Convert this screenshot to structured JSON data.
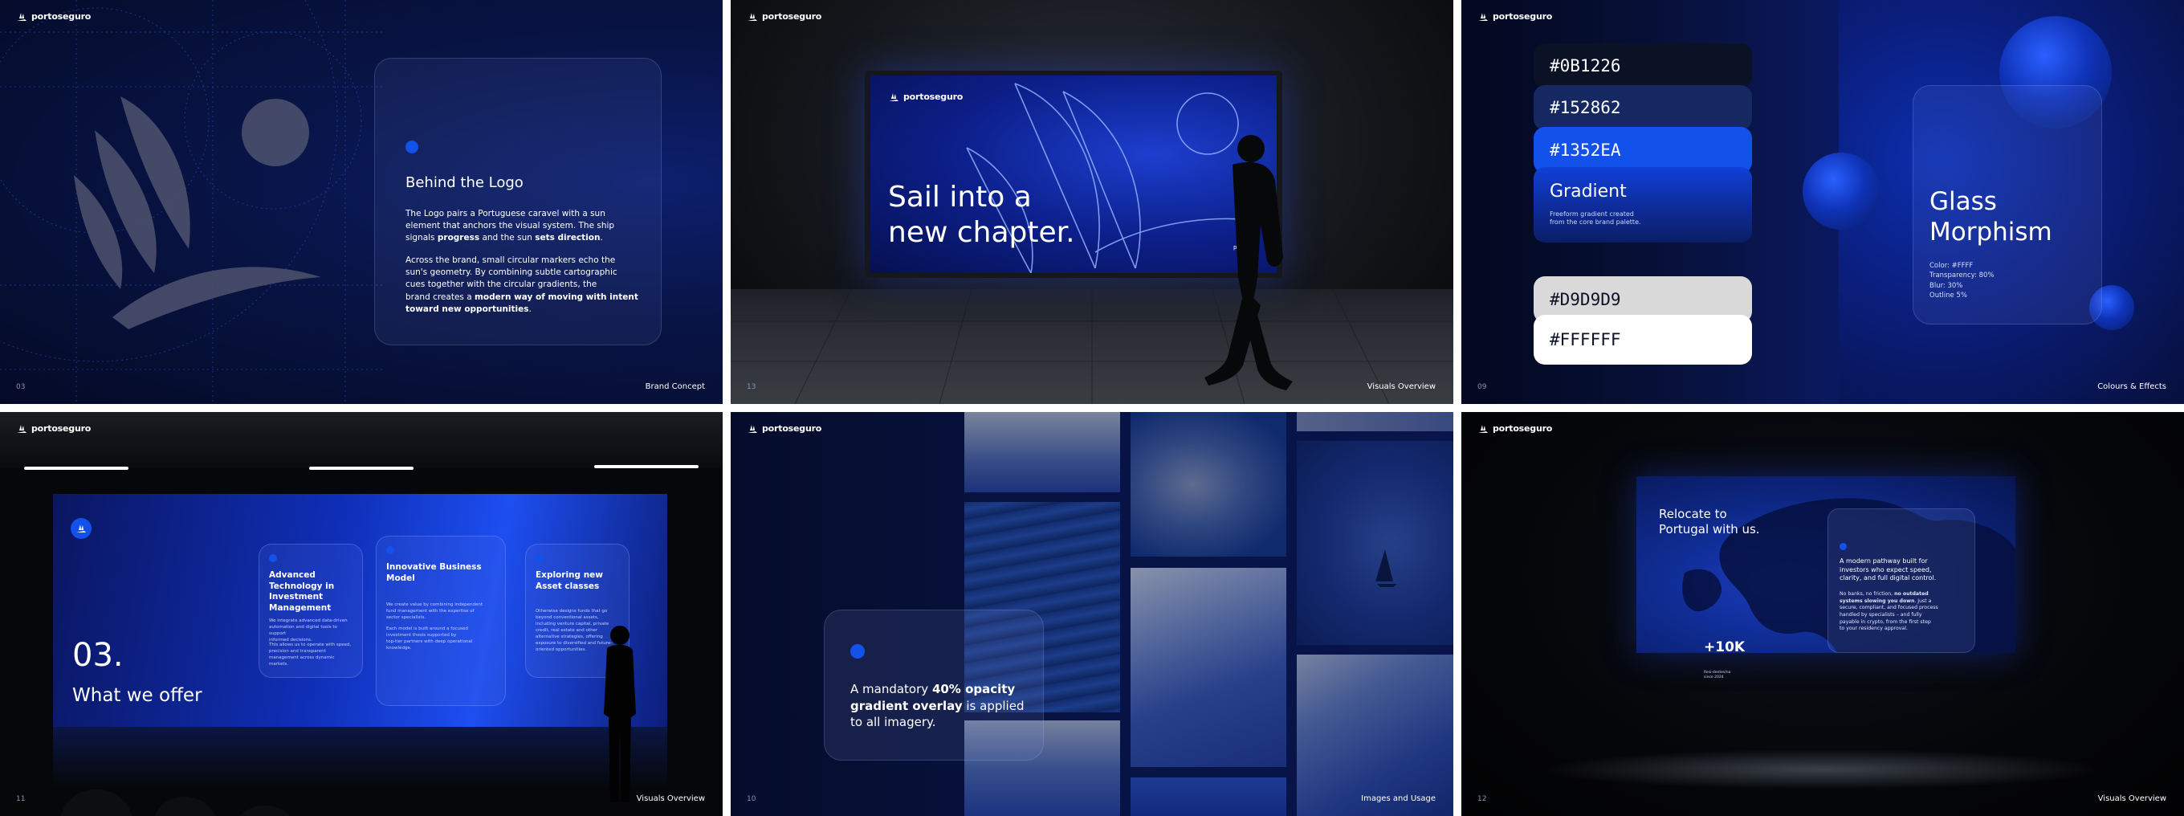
{
  "brand": "portoseguro",
  "colors": {
    "primary": "#0B1226",
    "secondary": "#152862",
    "accent": "#1352EA",
    "light_grey": "#D9D9D9",
    "white": "#FFFFFF"
  },
  "slides": {
    "s1": {
      "page": "03",
      "section": "Brand Concept",
      "card": {
        "title": "Behind the Logo",
        "p1": [
          "The Logo pairs a Portuguese caravel with a sun",
          "element that anchors the visual system. The ship",
          "signals ",
          "progress",
          " and the sun ",
          "sets direction",
          "."
        ],
        "p2": [
          "Across the brand, small circular markers echo the",
          "sun's geometry. By combining subtle cartographic",
          "cues together with the circular gradients, the",
          "brand creates a ",
          "modern way of moving with intent",
          "toward new opportunities",
          "."
        ]
      }
    },
    "s2": {
      "page": "13",
      "section": "Visuals Overview",
      "billboard": {
        "line1": "Sail into a",
        "line2": "new chapter.",
        "corner": "port"
      }
    },
    "s3": {
      "page": "09",
      "section": "Colours & Effects",
      "swatches": [
        {
          "label": "#0B1226",
          "color": "#0B1226"
        },
        {
          "label": "#152862",
          "color": "#152862"
        },
        {
          "label": "#1352EA",
          "color": "#1352EA"
        }
      ],
      "gradient": {
        "title": "Gradient",
        "sub1": "Freeform gradient created",
        "sub2": "from the core brand palette."
      },
      "light_swatches": [
        {
          "label": "#D9D9D9",
          "color": "#D9D9D9"
        },
        {
          "label": "#FFFFFF",
          "color": "#FFFFFF"
        }
      ],
      "glass": {
        "title1": "Glass",
        "title2": "Morphism",
        "spec1": "Color: #FFFF",
        "spec2": "Transparency: 80%",
        "spec3": "Blur: 30%",
        "spec4": "Outline 5%"
      }
    },
    "s4": {
      "page": "11",
      "section": "Visuals Overview",
      "number": "03.",
      "heading": "What we offer",
      "cards": [
        {
          "title": "Advanced Technology in Investment Management",
          "b1": "We integrate advanced data-driven",
          "b2": "automation and digital tools to support",
          "b3": "informed decisions.",
          "b4": "This allows us to operate with speed,",
          "b5": "precision and transparent",
          "b6": "management across dynamic markets."
        },
        {
          "title": "Innovative Business Model",
          "b1": "We create value by combining independent",
          "b2": "fund management with the expertise of",
          "b3": "sector specialists.",
          "b4": "Each model is built around a focused",
          "b5": "investment thesis supported by",
          "b6": "top-tier partners with deep operational knowledge."
        },
        {
          "title": "Exploring new Asset classes",
          "b1": "Otherwise designs funds that go",
          "b2": "beyond conventional assets,",
          "b3": "including venture capital, private",
          "b4": "credit, real estate and other",
          "b5": "alternative strategies, offering",
          "b6": "exposure to diversified and future-oriented opportunities."
        }
      ]
    },
    "s5": {
      "page": "10",
      "section": "Images and Usage",
      "caption": [
        "A mandatory ",
        "40% opacity",
        "gradient overlay",
        " is applied",
        "to all imagery."
      ]
    },
    "s6": {
      "page": "12",
      "section": "Visuals Overview",
      "title1": "Relocate to",
      "title2": "Portugal with us.",
      "stat": "+10K",
      "stat_sub1": "Resi-dentes/na",
      "stat_sub2": "since 2024",
      "p1": [
        "A modern pathway built for",
        "investors who expect speed,",
        "clarity, and full digital control."
      ],
      "p2": [
        "No banks, no friction, ",
        "no outdated",
        "systems slowing you down",
        ". Just a",
        "secure, compliant, and focused process",
        "handled by specialists – and fully",
        "payable in crypto, from the first step",
        "to your residency approval."
      ]
    }
  }
}
